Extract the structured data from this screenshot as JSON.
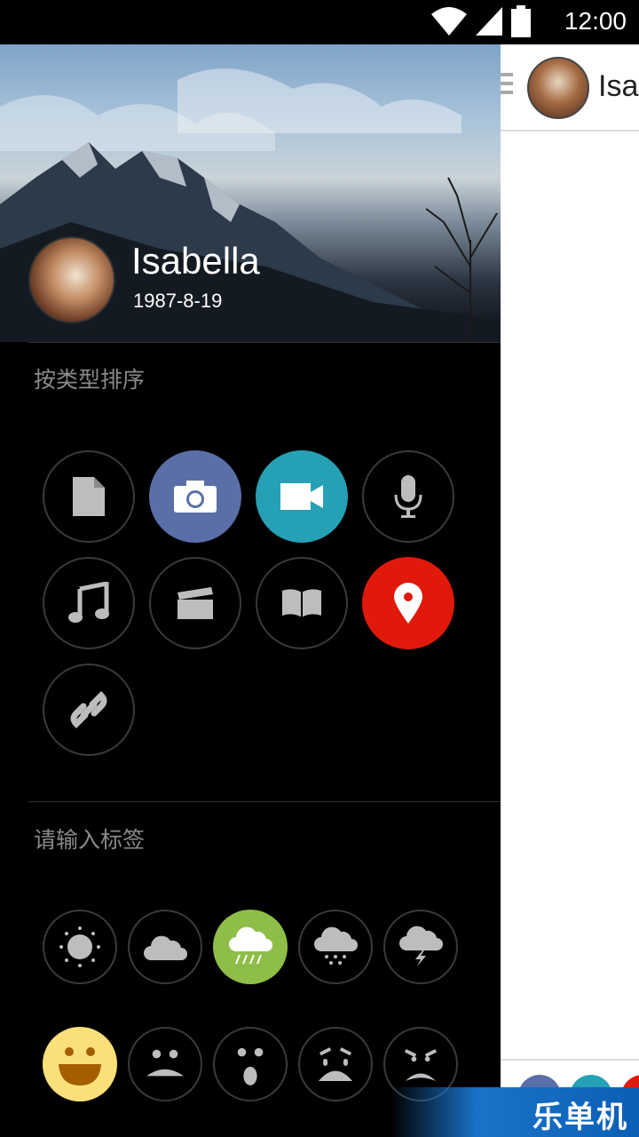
{
  "status_bar": {
    "time": "12:00"
  },
  "main_panel": {
    "name_partial": "Isa"
  },
  "profile": {
    "name": "Isabella",
    "birthdate": "1987-8-19"
  },
  "sort_section": {
    "title": "按类型排序",
    "types": [
      {
        "icon": "document-icon",
        "active": false
      },
      {
        "icon": "camera-icon",
        "active": true,
        "color": "#5a6fa8"
      },
      {
        "icon": "video-icon",
        "active": true,
        "color": "#25a0b4"
      },
      {
        "icon": "microphone-icon",
        "active": false
      },
      {
        "icon": "music-note-icon",
        "active": false
      },
      {
        "icon": "clapperboard-icon",
        "active": false
      },
      {
        "icon": "book-icon",
        "active": false
      },
      {
        "icon": "location-pin-icon",
        "active": true,
        "color": "#e0190a"
      },
      {
        "icon": "link-icon",
        "active": false
      }
    ]
  },
  "tag_section": {
    "title": "请输入标签",
    "weather": [
      {
        "icon": "sunny-icon",
        "active": false
      },
      {
        "icon": "cloudy-icon",
        "active": false
      },
      {
        "icon": "rain-icon",
        "active": true,
        "color": "#8fbe48"
      },
      {
        "icon": "snow-icon",
        "active": false
      },
      {
        "icon": "thunderstorm-icon",
        "active": false
      }
    ],
    "moods": [
      {
        "icon": "happy-face-icon",
        "active": true,
        "color": "#fbe07a"
      },
      {
        "icon": "sad-face-icon",
        "active": false
      },
      {
        "icon": "surprised-face-icon",
        "active": false
      },
      {
        "icon": "crying-face-icon",
        "active": false
      },
      {
        "icon": "angry-face-icon",
        "active": false
      }
    ]
  },
  "watermark": {
    "text": "乐单机"
  }
}
